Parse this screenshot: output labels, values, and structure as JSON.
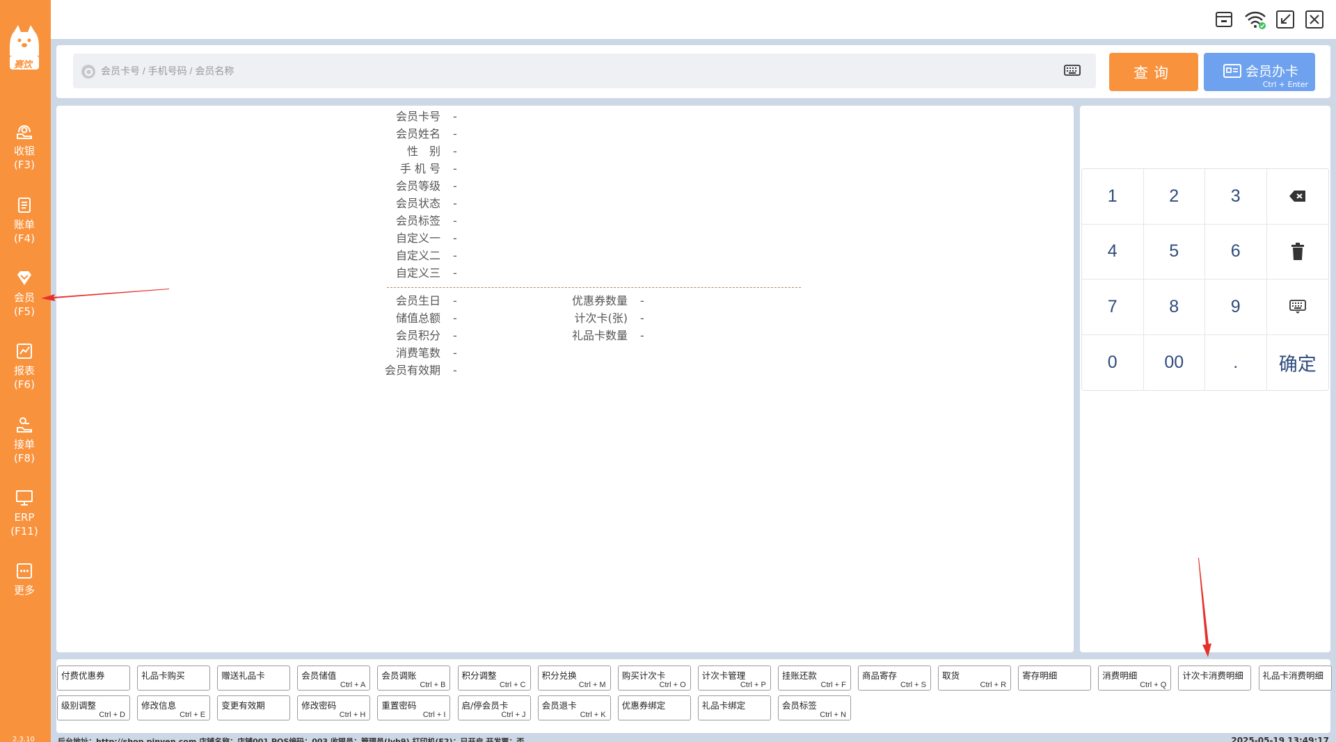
{
  "app": {
    "logo_text": "赛饮",
    "version": "2.3.10"
  },
  "sidebar": {
    "items": [
      {
        "label": "收银",
        "shortcut": "(F3)",
        "icon": "cashier-icon"
      },
      {
        "label": "账单",
        "shortcut": "(F4)",
        "icon": "bill-icon"
      },
      {
        "label": "会员",
        "shortcut": "(F5)",
        "icon": "member-icon"
      },
      {
        "label": "报表",
        "shortcut": "(F6)",
        "icon": "report-icon"
      },
      {
        "label": "接单",
        "shortcut": "(F8)",
        "icon": "order-icon"
      },
      {
        "label": "ERP",
        "shortcut": "(F11)",
        "icon": "monitor-icon"
      },
      {
        "label": "更多",
        "shortcut": "",
        "icon": "more-icon"
      }
    ]
  },
  "search": {
    "placeholder": "会员卡号 / 手机号码 / 会员名称",
    "query_label": "查询",
    "member_card_label": "会员办卡",
    "member_card_shortcut": "Ctrl + Enter"
  },
  "member_info": {
    "fields": [
      {
        "key": "会员卡号",
        "value": "-"
      },
      {
        "key": "会员姓名",
        "value": "-"
      },
      {
        "key": "性　别",
        "value": "-"
      },
      {
        "key": "手 机 号",
        "value": "-"
      },
      {
        "key": "会员等级",
        "value": "-"
      },
      {
        "key": "会员状态",
        "value": "-"
      },
      {
        "key": "会员标签",
        "value": "-"
      },
      {
        "key": "自定义一",
        "value": "-"
      },
      {
        "key": "自定义二",
        "value": "-"
      },
      {
        "key": "自定义三",
        "value": "-"
      }
    ],
    "stats_left": [
      {
        "key": "会员生日",
        "value": "-"
      },
      {
        "key": "储值总额",
        "value": "-"
      },
      {
        "key": "会员积分",
        "value": "-"
      },
      {
        "key": "消费笔数",
        "value": "-"
      },
      {
        "key": "会员有效期",
        "value": "-"
      }
    ],
    "stats_right": [
      {
        "key": "优惠券数量",
        "value": "-"
      },
      {
        "key": "计次卡(张)",
        "value": "-"
      },
      {
        "key": "礼品卡数量",
        "value": "-"
      }
    ]
  },
  "keypad": {
    "keys": [
      "1",
      "2",
      "3",
      "backspace",
      "4",
      "5",
      "6",
      "delete",
      "7",
      "8",
      "9",
      "keyboard",
      "0",
      "00",
      ".",
      "确定"
    ]
  },
  "function_buttons": {
    "row1": [
      {
        "label": "付费优惠券",
        "shortcut": ""
      },
      {
        "label": "礼品卡购买",
        "shortcut": ""
      },
      {
        "label": "赠送礼品卡",
        "shortcut": ""
      },
      {
        "label": "会员储值",
        "shortcut": "Ctrl + A"
      },
      {
        "label": "会员调账",
        "shortcut": "Ctrl + B"
      },
      {
        "label": "积分调整",
        "shortcut": "Ctrl + C"
      },
      {
        "label": "积分兑换",
        "shortcut": "Ctrl + M"
      },
      {
        "label": "购买计次卡",
        "shortcut": "Ctrl + O"
      },
      {
        "label": "计次卡管理",
        "shortcut": "Ctrl + P"
      },
      {
        "label": "挂账还款",
        "shortcut": "Ctrl + F"
      },
      {
        "label": "商品寄存",
        "shortcut": "Ctrl + S"
      },
      {
        "label": "取货",
        "shortcut": "Ctrl + R"
      },
      {
        "label": "寄存明细",
        "shortcut": ""
      },
      {
        "label": "消费明细",
        "shortcut": "Ctrl + Q"
      },
      {
        "label": "计次卡消费明细",
        "shortcut": ""
      },
      {
        "label": "礼品卡消费明细",
        "shortcut": ""
      }
    ],
    "row2": [
      {
        "label": "级别调整",
        "shortcut": "Ctrl + D"
      },
      {
        "label": "修改信息",
        "shortcut": "Ctrl + E"
      },
      {
        "label": "变更有效期",
        "shortcut": ""
      },
      {
        "label": "修改密码",
        "shortcut": "Ctrl + H"
      },
      {
        "label": "重置密码",
        "shortcut": "Ctrl + I"
      },
      {
        "label": "启/停会员卡",
        "shortcut": "Ctrl + J"
      },
      {
        "label": "会员退卡",
        "shortcut": "Ctrl + K"
      },
      {
        "label": "优惠券绑定",
        "shortcut": ""
      },
      {
        "label": "礼品卡绑定",
        "shortcut": ""
      },
      {
        "label": "会员标签",
        "shortcut": "Ctrl + N"
      }
    ]
  },
  "status_bar": {
    "text": "后台地址：http://shop.pinyen.com  店铺名称：店铺001  POS编码：003  收银员：管理员(lyh9)  打印机(F2)：已开启  开发票：否",
    "datetime": "2025-05-19 13:49:17"
  },
  "colors": {
    "brand_orange": "#f9923c",
    "member_button_blue": "#6ea2ee",
    "background": "#cdd8e6",
    "keypad_text": "#2f4b7c",
    "annotation_arrow": "#e8302a"
  }
}
